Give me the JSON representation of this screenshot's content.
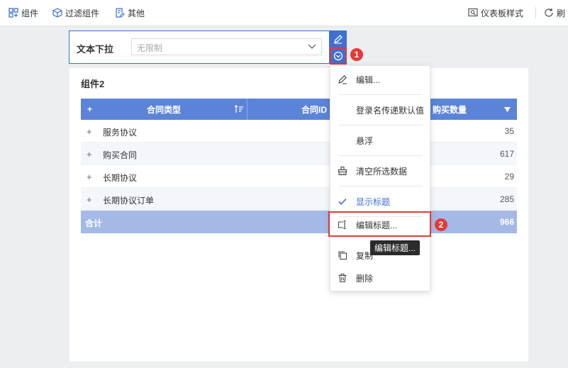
{
  "toolbar": {
    "component_label": "组件",
    "filter_component_label": "过滤组件",
    "other_label": "其他",
    "dashboard_style_label": "仪表板样式",
    "refresh_label": "刷"
  },
  "filter_widget": {
    "title": "文本下拉",
    "placeholder": "无限制"
  },
  "badges": {
    "one": "1",
    "two": "2"
  },
  "panel": {
    "title": "组件2",
    "expand_all": "+",
    "columns": [
      "合同类型",
      "合同ID",
      "购买数量"
    ],
    "rows": [
      {
        "name": "服务协议",
        "value": "35"
      },
      {
        "name": "购买合同",
        "value": "617"
      },
      {
        "name": "长期协议",
        "value": "29"
      },
      {
        "name": "长期协议订单",
        "value": "285"
      }
    ],
    "row_expander": "+",
    "total_label": "合计",
    "total_value": "966"
  },
  "menu": {
    "items": [
      {
        "label": "编辑..."
      },
      {
        "label": "登录名传递默认值"
      },
      {
        "label": "悬浮"
      },
      {
        "label": "清空所选数据"
      },
      {
        "label": "显示标题"
      },
      {
        "label": "编辑标题..."
      },
      {
        "label": "复制"
      },
      {
        "label": "删除"
      }
    ]
  },
  "tooltip": "编辑标题...",
  "colors": {
    "accent": "#3f6fd1",
    "header": "#5b84d8",
    "total": "#a4b9e6",
    "highlight": "#e53935"
  }
}
